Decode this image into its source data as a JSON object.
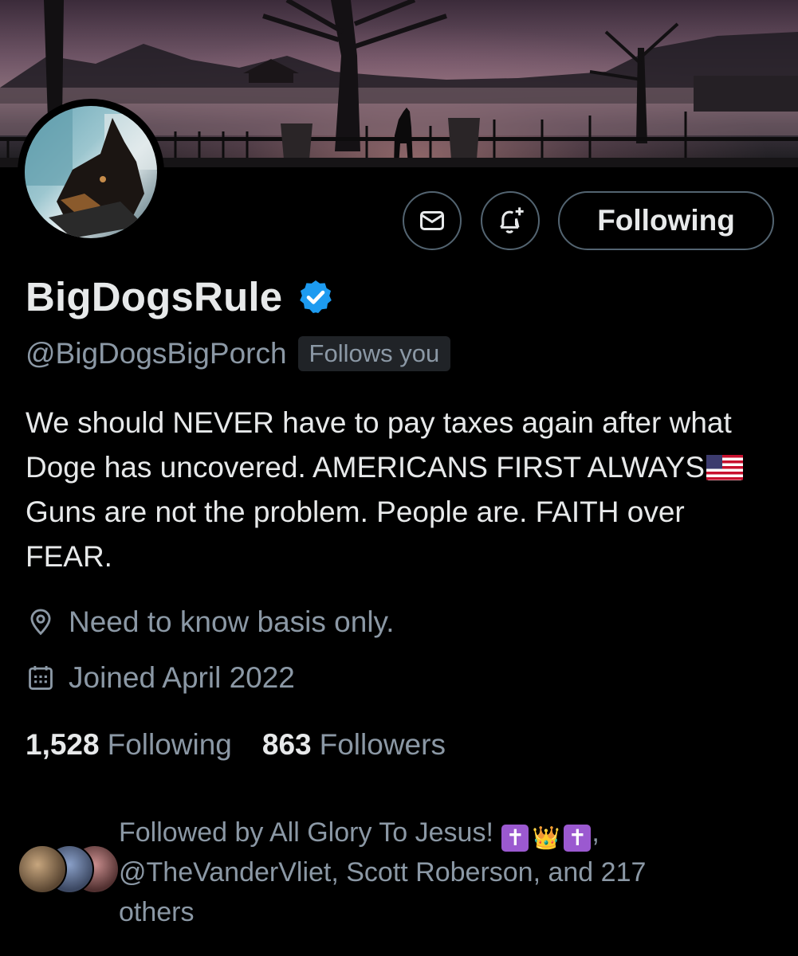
{
  "profile": {
    "display_name": "BigDogsRule",
    "handle": "@BigDogsBigPorch",
    "follows_you_badge": "Follows you",
    "bio_part1": "We should NEVER have to pay taxes again after what Doge has uncovered. AMERICANS FIRST ALWAYS",
    "bio_part2": "Guns are not the problem. People are. FAITH over FEAR.",
    "location": "Need to know basis only.",
    "joined": "Joined April 2022",
    "verified": true
  },
  "actions": {
    "following_label": "Following",
    "message_icon": "mail-icon",
    "notify_icon": "bell-plus-icon"
  },
  "stats": {
    "following_count": "1,528",
    "following_label": "Following",
    "followers_count": "863",
    "followers_label": "Followers"
  },
  "followed_by": {
    "prefix": "Followed by All Glory To Jesus! ",
    "emojis": [
      "✝",
      "👑",
      "✝"
    ],
    "suffix": ", @TheVanderVliet, Scott Roberson, and 217 others"
  },
  "colors": {
    "background": "#000000",
    "text_primary": "#e7e9ea",
    "text_secondary": "#8b98a5",
    "button_border": "#536471",
    "verified_blue": "#1d9bf0"
  }
}
